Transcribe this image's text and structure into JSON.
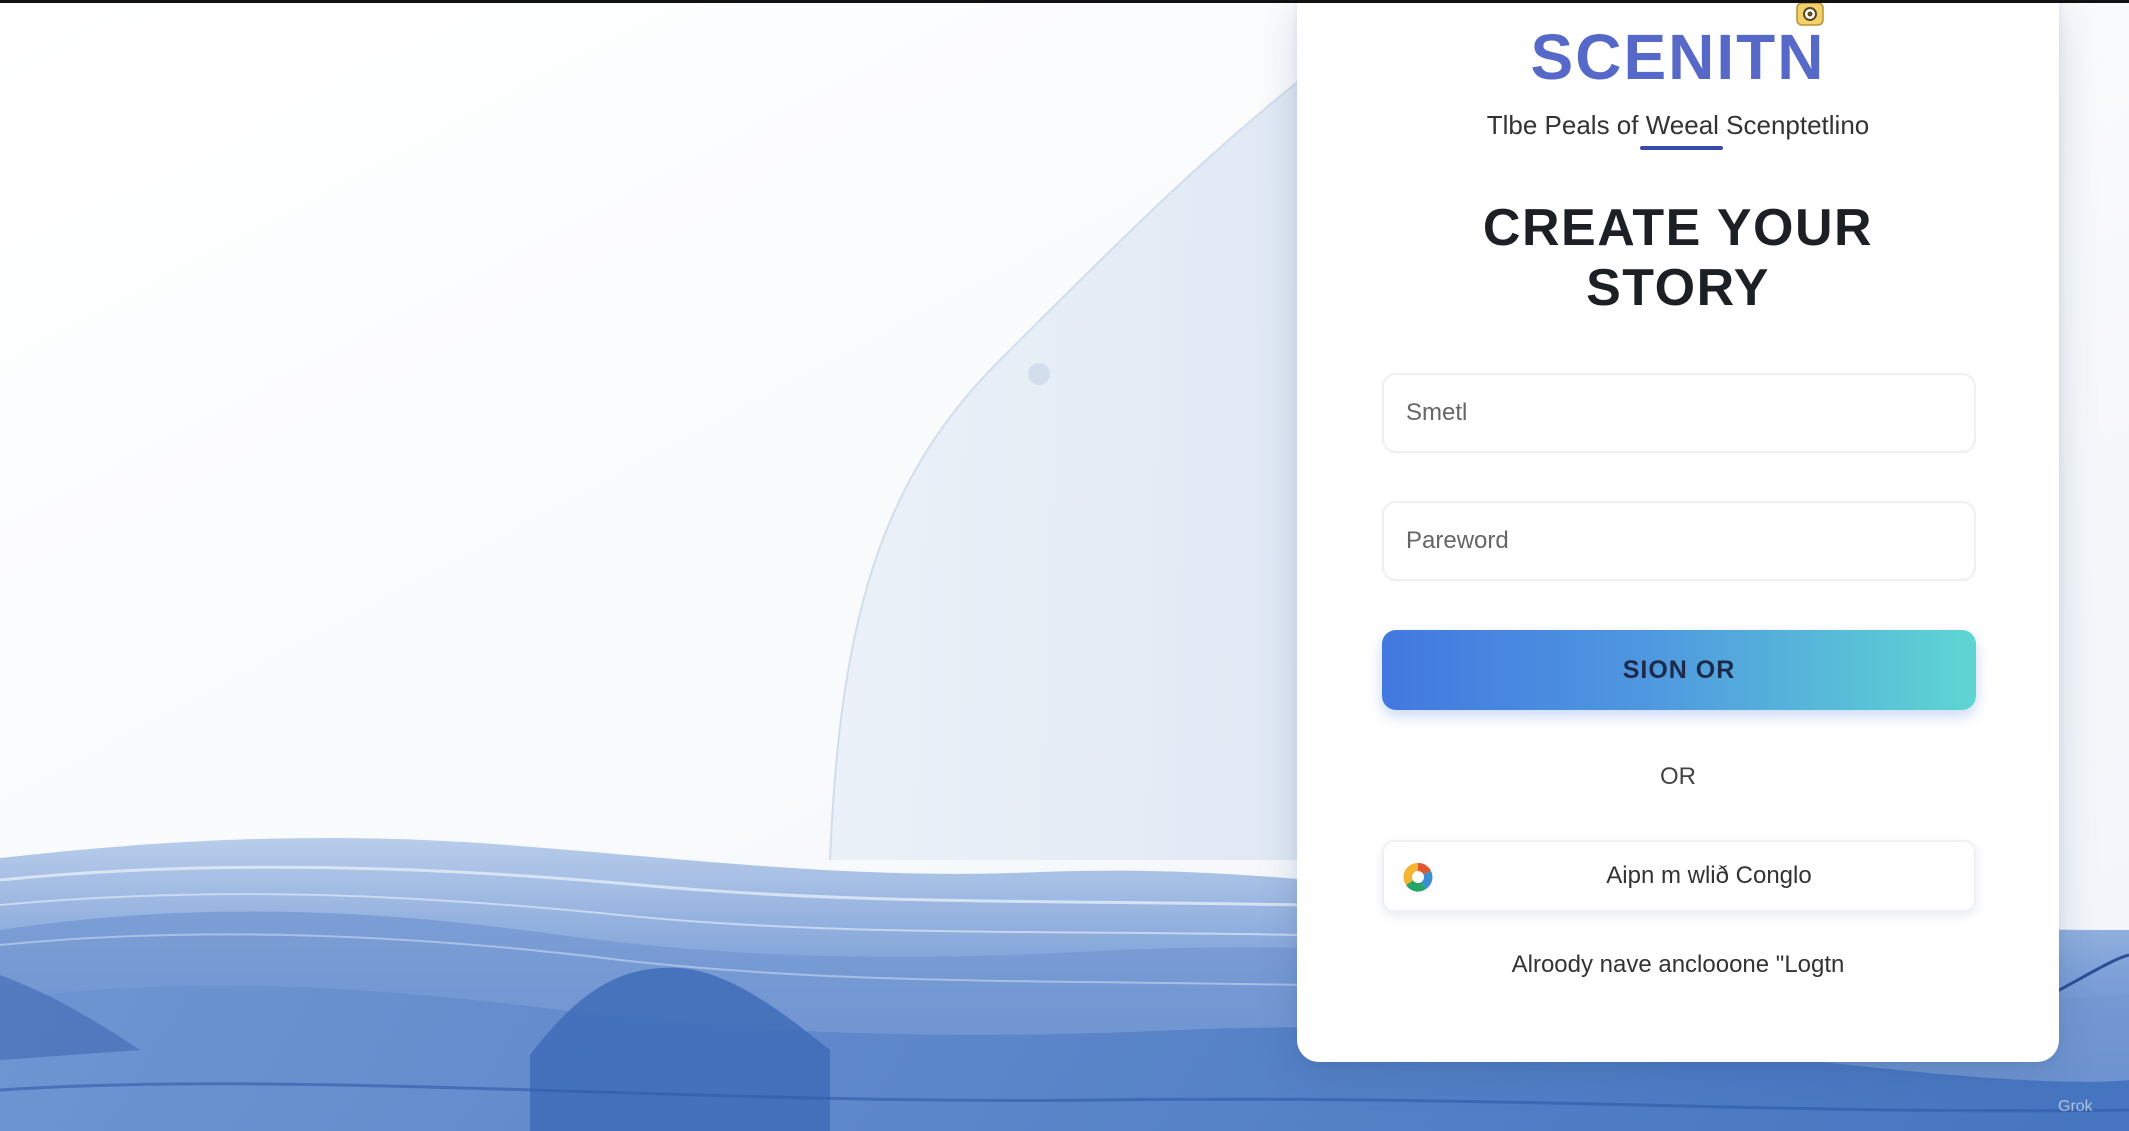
{
  "brand": {
    "logo_text": "SCENITN",
    "tagline": "Tlbe Peals of Weeal Scenptetlino"
  },
  "form": {
    "heading_line1": "CREATE YOUR",
    "heading_line2": "STORY",
    "email_placeholder": "Smetl",
    "password_placeholder": "Pareword",
    "submit_label": "SION OR",
    "divider_text": "OR",
    "google_label": "Aipn m wlið Conglo",
    "login_prompt": "Alroody nave anclooone \"Logtn"
  },
  "watermark": "Grok",
  "icons": {
    "logo_badge": "badge-icon",
    "google": "google-icon"
  },
  "colors": {
    "brand": "#5669c9",
    "button_start": "#4278e0",
    "button_end": "#5ed6d2",
    "wave": "#5b86c9"
  }
}
